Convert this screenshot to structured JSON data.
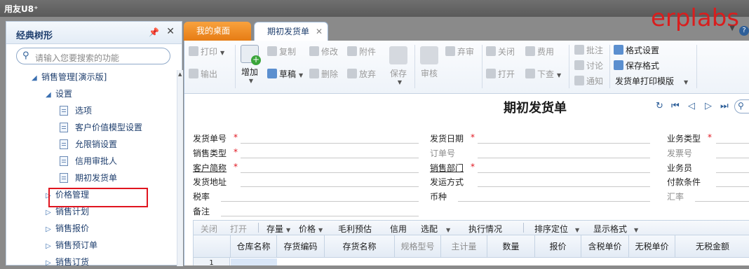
{
  "app": {
    "logo": "用友U8⁺",
    "watermark": "erplabs"
  },
  "left_panel": {
    "title": "经典树形",
    "pin_icon": "pin-icon",
    "close_icon": "close-icon",
    "search_placeholder": "请输入您要搜索的功能",
    "tree": [
      {
        "label": "销售管理[演示版]",
        "level": 1,
        "expanded": true,
        "kind": "folder"
      },
      {
        "label": "设置",
        "level": 2,
        "expanded": true,
        "kind": "folder"
      },
      {
        "label": "选项",
        "level": 3,
        "kind": "leaf"
      },
      {
        "label": "客户价值模型设置",
        "level": 3,
        "kind": "leaf"
      },
      {
        "label": "允限销设置",
        "level": 3,
        "kind": "leaf"
      },
      {
        "label": "信用审批人",
        "level": 3,
        "kind": "leaf"
      },
      {
        "label": "期初发货单",
        "level": 3,
        "kind": "leaf",
        "highlighted": true
      },
      {
        "label": "价格管理",
        "level": 2,
        "expanded": false,
        "kind": "folder"
      },
      {
        "label": "销售计划",
        "level": 2,
        "expanded": false,
        "kind": "folder"
      },
      {
        "label": "销售报价",
        "level": 2,
        "expanded": false,
        "kind": "folder"
      },
      {
        "label": "销售预订单",
        "level": 2,
        "expanded": false,
        "kind": "folder"
      },
      {
        "label": "销售订货",
        "level": 2,
        "expanded": false,
        "kind": "folder"
      }
    ]
  },
  "tabs": [
    {
      "label": "我的桌面",
      "active": false
    },
    {
      "label": "期初发货单",
      "active": true,
      "closable": true
    }
  ],
  "toolbar": {
    "print": "打印",
    "export": "输出",
    "add": "增加",
    "copy": "复制",
    "draft": "草稿",
    "edit": "修改",
    "delete": "删除",
    "attach": "附件",
    "abandon": "放弃",
    "save": "保存",
    "audit": "审核",
    "unaudit": "弃审",
    "close": "关闭",
    "open": "打开",
    "fee": "费用",
    "push_down": "下查",
    "annotate": "批注",
    "discuss": "讨论",
    "notify": "通知",
    "format_settings": "格式设置",
    "save_format": "保存格式",
    "print_template": "发货单打印模版"
  },
  "form": {
    "title": "期初发货单",
    "fields": [
      {
        "label": "发货单号",
        "required": true
      },
      {
        "label": "发货日期",
        "required": true
      },
      {
        "label": "业务类型",
        "required": true
      },
      {
        "label": "销售类型",
        "required": true
      },
      {
        "label": "订单号",
        "required": false,
        "disabled": true
      },
      {
        "label": "发票号",
        "required": false,
        "disabled": true
      },
      {
        "label": "客户简称",
        "required": true,
        "underline": true
      },
      {
        "label": "销售部门",
        "required": true,
        "underline": true
      },
      {
        "label": "业务员",
        "required": false
      },
      {
        "label": "发货地址",
        "required": false
      },
      {
        "label": "发运方式",
        "required": false
      },
      {
        "label": "付款条件",
        "required": false
      },
      {
        "label": "税率",
        "required": false
      },
      {
        "label": "币种",
        "required": false
      },
      {
        "label": "汇率",
        "required": false,
        "disabled": true
      },
      {
        "label": "备注",
        "required": false
      }
    ]
  },
  "grid_toolbar": {
    "close": "关闭",
    "open": "打开",
    "stock": "存量",
    "price": "价格",
    "gross_profit": "毛利预估",
    "credit": "信用",
    "select": "选配",
    "execution": "执行情况",
    "sort": "排序定位",
    "display_format": "显示格式"
  },
  "grid": {
    "columns": [
      "仓库名称",
      "存货编码",
      "存货名称",
      "规格型号",
      "主计量",
      "数量",
      "报价",
      "含税单价",
      "无税单价",
      "无税金额"
    ],
    "disabled_columns": [
      "规格型号",
      "主计量"
    ],
    "rows": [
      "1"
    ]
  }
}
